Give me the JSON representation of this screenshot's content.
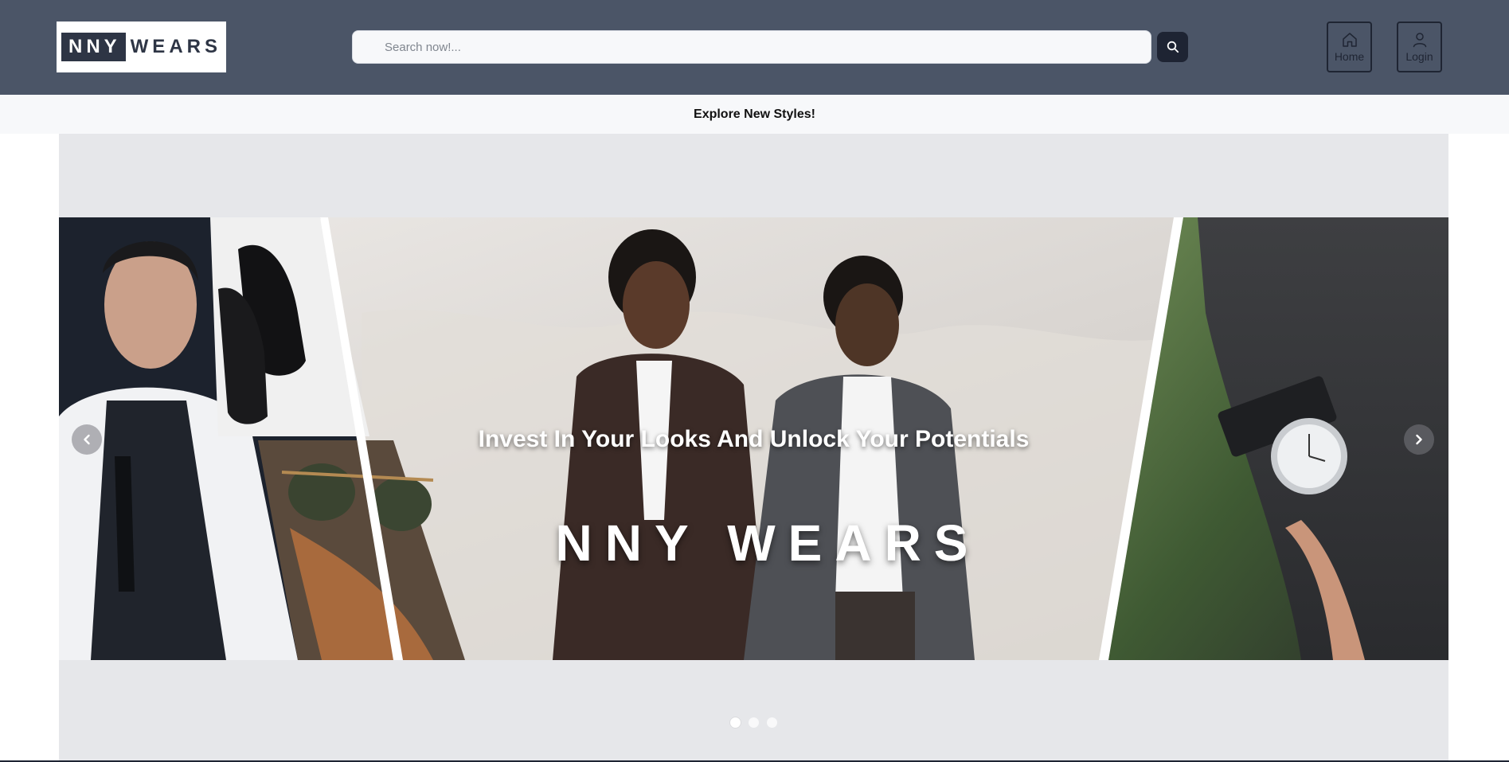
{
  "header": {
    "logo": {
      "part1": "NNY",
      "part2": "WEARS"
    },
    "search": {
      "placeholder": "Search now!..."
    },
    "nav": [
      {
        "label": "Home",
        "icon": "home-icon"
      },
      {
        "label": "Login",
        "icon": "user-icon"
      }
    ],
    "colors": {
      "bar": "#4b5567",
      "accent": "#1e2433"
    }
  },
  "announcement": {
    "text": "Explore New Styles!"
  },
  "carousel": {
    "tagline": "Invest In Your Looks And Unlock Your Potentials",
    "brand": "NNY WEARS",
    "prev_icon": "chevron-left-icon",
    "next_icon": "chevron-right-icon",
    "slides_count": 3,
    "active_slide": 1
  }
}
